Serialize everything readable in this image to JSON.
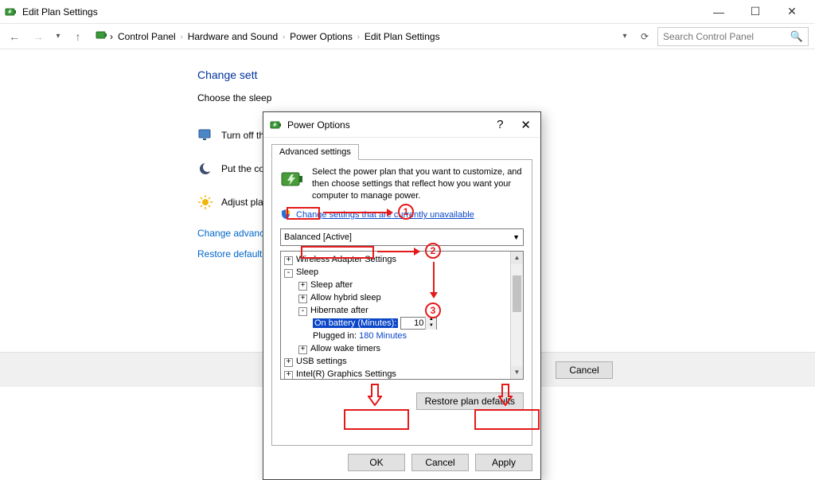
{
  "window": {
    "title": "Edit Plan Settings",
    "controls": {
      "min": "—",
      "max": "☐",
      "close": "✕"
    }
  },
  "nav": {
    "back": "←",
    "fwd": "→",
    "up": "↑",
    "crumbs": [
      "Control Panel",
      "Hardware and Sound",
      "Power Options",
      "Edit Plan Settings"
    ],
    "search_placeholder": "Search Control Panel"
  },
  "bg": {
    "heading": "Change sett",
    "sub": "Choose the sleep",
    "rows": [
      "Turn off the",
      "Put the com",
      "Adjust plan"
    ],
    "links": [
      "Change advance",
      "Restore default s"
    ],
    "cancel": "Cancel"
  },
  "dlg": {
    "title": "Power Options",
    "help": "?",
    "close": "✕",
    "tab": "Advanced settings",
    "intro": "Select the power plan that you want to customize, and then choose settings that reflect how you want your computer to manage power.",
    "shield_link": "Change settings that are currently unavailable",
    "plan": "Balanced [Active]",
    "tree": {
      "wireless": "Wireless Adapter Settings",
      "sleep": "Sleep",
      "sleep_after": "Sleep after",
      "allow_hybrid": "Allow hybrid sleep",
      "hibernate": "Hibernate after",
      "on_batt_label": "On battery (Minutes):",
      "on_batt_val": "10",
      "plugged_label": "Plugged in:",
      "plugged_val": "180 Minutes",
      "wake": "Allow wake timers",
      "usb": "USB settings",
      "intel": "Intel(R) Graphics Settings"
    },
    "restore": "Restore plan defaults",
    "ok": "OK",
    "cancel": "Cancel",
    "apply": "Apply"
  },
  "ann": {
    "1": "1",
    "2": "2",
    "3": "3"
  }
}
